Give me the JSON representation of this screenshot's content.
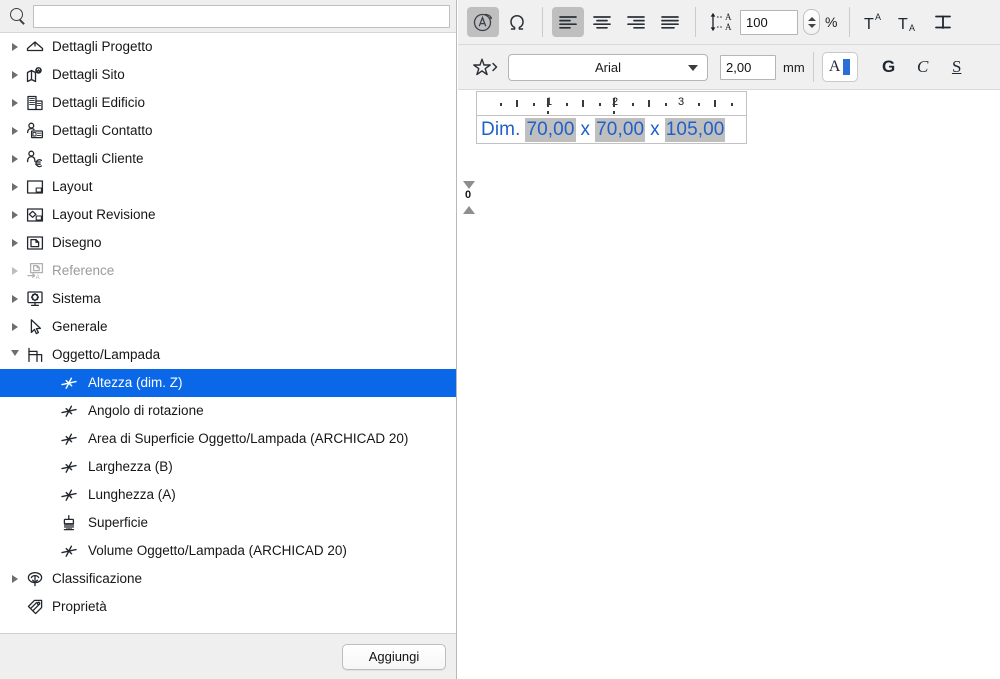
{
  "search": {
    "value": "",
    "placeholder": "",
    "icon": "search-icon"
  },
  "tree": {
    "items": [
      {
        "label": "Dettagli Progetto",
        "icon": "house-icon",
        "level": 0,
        "twisty": "closed",
        "selected": false,
        "dim": false
      },
      {
        "label": "Dettagli Sito",
        "icon": "map-pin-icon",
        "level": 0,
        "twisty": "closed",
        "selected": false,
        "dim": false
      },
      {
        "label": "Dettagli Edificio",
        "icon": "building-icon",
        "level": 0,
        "twisty": "closed",
        "selected": false,
        "dim": false
      },
      {
        "label": "Dettagli Contatto",
        "icon": "contact-card-icon",
        "level": 0,
        "twisty": "closed",
        "selected": false,
        "dim": false
      },
      {
        "label": "Dettagli Cliente",
        "icon": "client-euro-icon",
        "level": 0,
        "twisty": "closed",
        "selected": false,
        "dim": false
      },
      {
        "label": "Layout",
        "icon": "layout-icon",
        "level": 0,
        "twisty": "closed",
        "selected": false,
        "dim": false
      },
      {
        "label": "Layout Revisione",
        "icon": "layout-revision-icon",
        "level": 0,
        "twisty": "closed",
        "selected": false,
        "dim": false
      },
      {
        "label": "Disegno",
        "icon": "drawing-icon",
        "level": 0,
        "twisty": "closed",
        "selected": false,
        "dim": false
      },
      {
        "label": "Reference",
        "icon": "reference-icon",
        "level": 0,
        "twisty": "closed-pale",
        "selected": false,
        "dim": true
      },
      {
        "label": "Sistema",
        "icon": "system-icon",
        "level": 0,
        "twisty": "closed",
        "selected": false,
        "dim": false
      },
      {
        "label": "Generale",
        "icon": "arrow-cursor-icon",
        "level": 0,
        "twisty": "closed",
        "selected": false,
        "dim": false
      },
      {
        "label": "Oggetto/Lampada",
        "icon": "object-lamp-icon",
        "level": 0,
        "twisty": "open",
        "selected": false,
        "dim": false
      },
      {
        "label": "Altezza (dim. Z)",
        "icon": "parameter-icon",
        "level": 1,
        "twisty": "none",
        "selected": true,
        "dim": false
      },
      {
        "label": "Angolo di rotazione",
        "icon": "parameter-icon",
        "level": 1,
        "twisty": "none",
        "selected": false,
        "dim": false
      },
      {
        "label": "Area di Superficie Oggetto/Lampada (ARCHICAD 20)",
        "icon": "parameter-icon",
        "level": 1,
        "twisty": "none",
        "selected": false,
        "dim": false
      },
      {
        "label": "Larghezza (B)",
        "icon": "parameter-icon",
        "level": 1,
        "twisty": "none",
        "selected": false,
        "dim": false
      },
      {
        "label": "Lunghezza (A)",
        "icon": "parameter-icon",
        "level": 1,
        "twisty": "none",
        "selected": false,
        "dim": false
      },
      {
        "label": "Superficie",
        "icon": "surface-brush-icon",
        "level": 1,
        "twisty": "none",
        "selected": false,
        "dim": false
      },
      {
        "label": "Volume Oggetto/Lampada (ARCHICAD 20)",
        "icon": "parameter-icon",
        "level": 1,
        "twisty": "none",
        "selected": false,
        "dim": false
      },
      {
        "label": "Classificazione",
        "icon": "classification-icon",
        "level": 0,
        "twisty": "closed",
        "selected": false,
        "dim": false
      },
      {
        "label": "Proprietà",
        "icon": "property-tag-icon",
        "level": 0,
        "twisty": "none",
        "selected": false,
        "dim": false
      }
    ]
  },
  "footer": {
    "add_label": "Aggiungi"
  },
  "toolbar": {
    "row1": {
      "rotate_text_icon": "circled-a-rotate-icon",
      "special_char_icon": "omega-icon",
      "align_left_icon": "align-left-icon",
      "align_center_icon": "align-center-icon",
      "align_right_icon": "align-right-icon",
      "align_justify_icon": "align-justify-icon",
      "line_spacing_icon": "line-spacing-icon",
      "line_spacing_value": "100",
      "percent_label": "%",
      "superscript_icon": "superscript-icon",
      "subscript_icon": "subscript-icon",
      "strikethrough_icon": "strikethrough-icon"
    },
    "row2": {
      "favorites_icon": "star-favorites-icon",
      "font_name": "Arial",
      "font_size": "2,00",
      "size_unit": "mm",
      "text_color_icon": "text-color-icon",
      "text_color": "#2b6fd6",
      "bold_label": "G",
      "italic_label": "C",
      "underline_label": "S"
    }
  },
  "editor": {
    "ruler": {
      "labels": [
        "0",
        "1",
        "2",
        "3"
      ]
    },
    "text": {
      "prefix": "Dim.",
      "value1": "70,00",
      "separator1": "x",
      "value2": "70,00",
      "separator2": "x",
      "value3": "105,00"
    }
  },
  "colors": {
    "selection_blue": "#0a68e8",
    "text_blue": "#2060c8",
    "text_selection_grey": "#bfbfbf",
    "toolbar_bg": "#f0f0f0"
  }
}
